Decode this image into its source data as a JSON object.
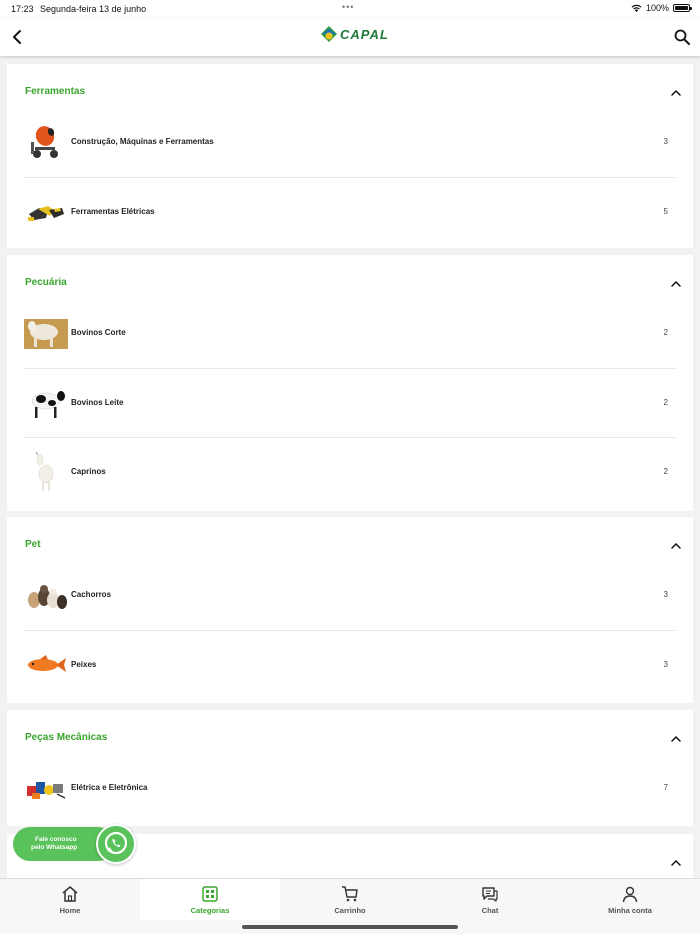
{
  "status_bar": {
    "time": "17:23",
    "date": "Segunda-feira 13 de junho",
    "dots": "•••",
    "battery_text": "100%"
  },
  "header": {
    "logo_text": "CAPAL",
    "back_icon": "chevron-left-icon",
    "search_icon": "search-icon"
  },
  "colors": {
    "accent": "#3aa52e",
    "whatsapp": "#59c25a",
    "logo": "#1f7a3a"
  },
  "categories": [
    {
      "title": "Ferramentas",
      "items": [
        {
          "label": "Construção, Máquinas e Ferramentas",
          "count": "3",
          "thumb": "cement-mixer"
        },
        {
          "label": "Ferramentas Elétricas",
          "count": "5",
          "thumb": "power-tools"
        }
      ]
    },
    {
      "title": "Pecuária",
      "items": [
        {
          "label": "Bovinos Corte",
          "count": "2",
          "thumb": "beef-cattle"
        },
        {
          "label": "Bovinos Leite",
          "count": "2",
          "thumb": "dairy-cow"
        },
        {
          "label": "Caprinos",
          "count": "2",
          "thumb": "goat"
        }
      ]
    },
    {
      "title": "Pet",
      "items": [
        {
          "label": "Cachorros",
          "count": "3",
          "thumb": "dogs"
        },
        {
          "label": "Peixes",
          "count": "3",
          "thumb": "fish"
        }
      ]
    },
    {
      "title": "Peças Mecânicas",
      "items": [
        {
          "label": "Elétrica e Eletrônica",
          "count": "7",
          "thumb": "electrical-parts"
        }
      ]
    }
  ],
  "whatsapp": {
    "line1": "Fale conosco",
    "line2": "pelo Whatsapp"
  },
  "bottom_nav": [
    {
      "label": "Home",
      "icon": "home-icon",
      "active": false
    },
    {
      "label": "Categorias",
      "icon": "categories-icon",
      "active": true
    },
    {
      "label": "Carrinho",
      "icon": "cart-icon",
      "active": false
    },
    {
      "label": "Chat",
      "icon": "chat-icon",
      "active": false
    },
    {
      "label": "Minha conta",
      "icon": "user-icon",
      "active": false
    }
  ]
}
